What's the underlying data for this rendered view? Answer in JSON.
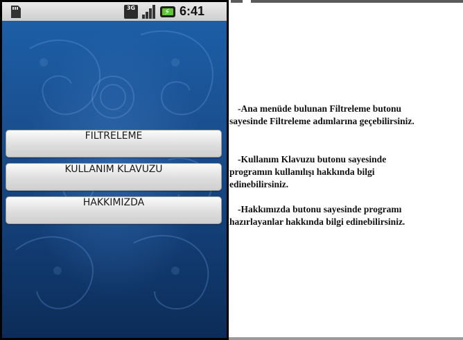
{
  "status_bar": {
    "network": "3G",
    "time": "6:41 PM"
  },
  "menu": {
    "buttons": [
      {
        "label": "FILTRELEME"
      },
      {
        "label": "KULLANIM KLAVUZU"
      },
      {
        "label": "HAKKIMIZDA"
      }
    ]
  },
  "help_text": {
    "p1_line1": "-Ana menüde bulunan Filtreleme butonu",
    "p1_line2": "sayesinde Filtreleme adımlarına geçebilirsiniz.",
    "p2_line1": "-Kullanım Klavuzu butonu sayesinde",
    "p2_line2": "programın kullanılışı hakkında bilgi",
    "p2_line3": "edinebilirsiniz.",
    "p3_line1": "-Hakkımızda butonu sayesinde programı",
    "p3_line2": "hazırlayanlar hakkında bilgi edinebilirsiniz."
  },
  "colors": {
    "background_blue": "#1a4f8f",
    "button_face": "#e4e4e4"
  }
}
